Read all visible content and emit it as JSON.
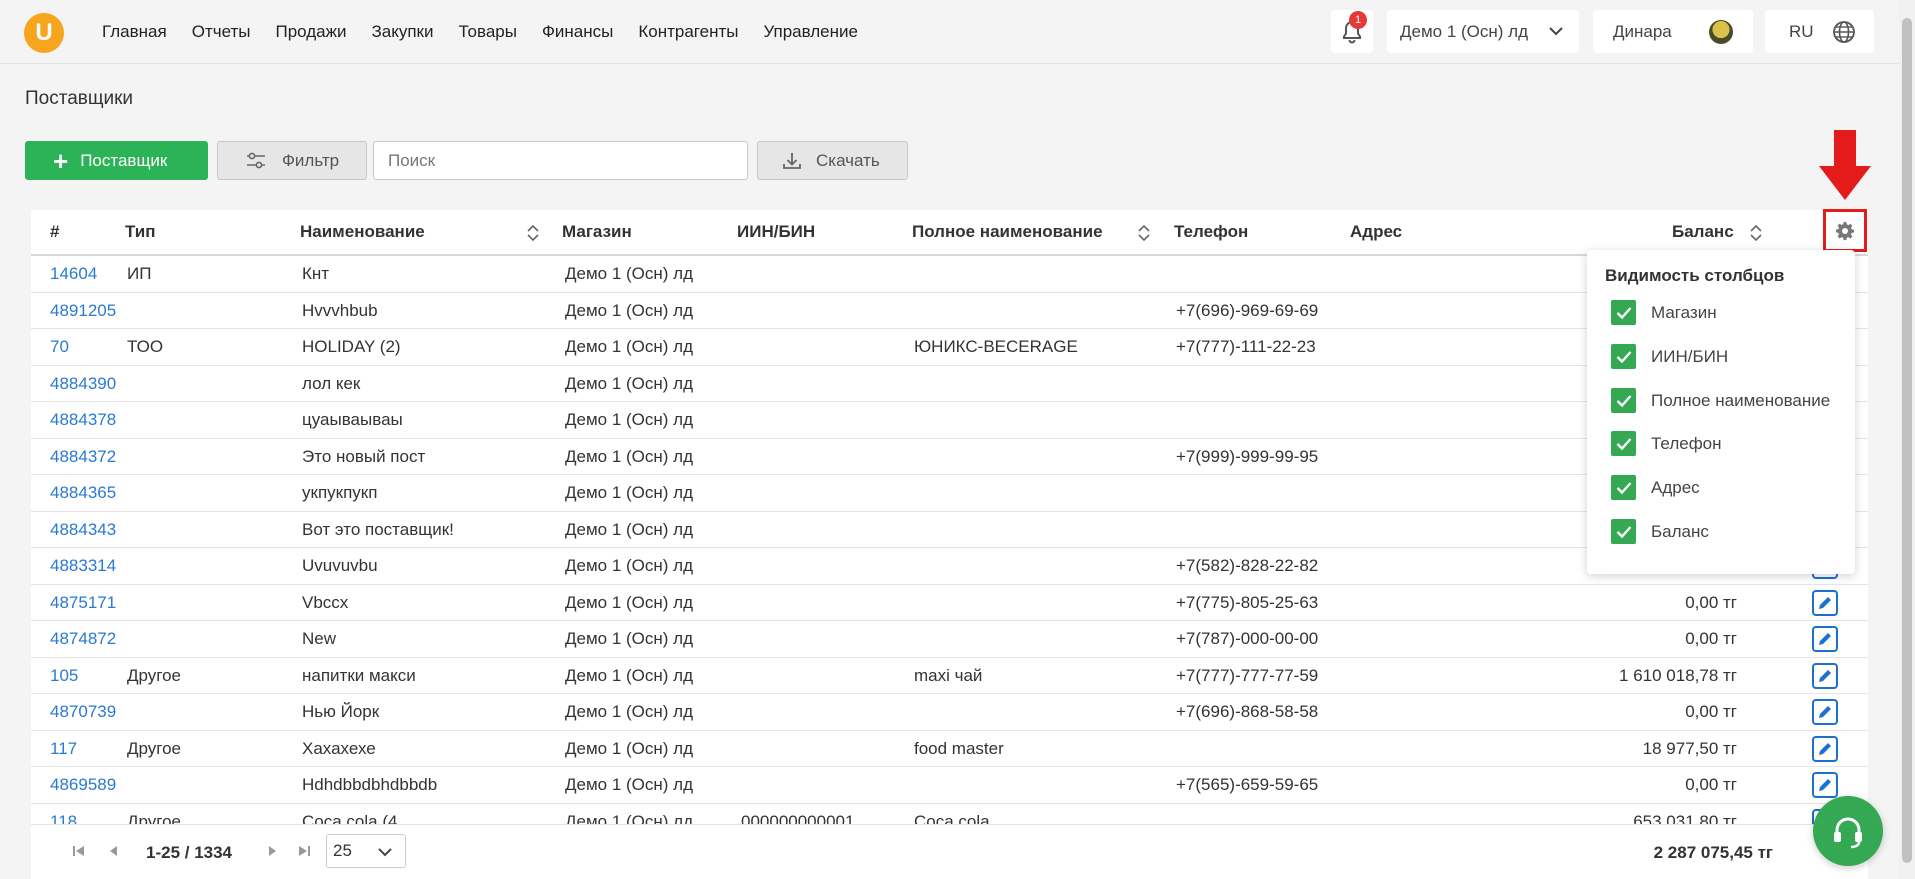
{
  "app": {
    "logo_letter": "U",
    "nav": [
      "Главная",
      "Отчеты",
      "Продажи",
      "Закупки",
      "Товары",
      "Финансы",
      "Контрагенты",
      "Управление"
    ],
    "notifications_count": "1",
    "store_selector": "Демо 1 (Осн) лд",
    "user_name": "Динара",
    "language": "RU"
  },
  "page": {
    "title": "Поставщики",
    "toolbar": {
      "add_label": "Поставщик",
      "filter_label": "Фильтр",
      "search_placeholder": "Поиск",
      "download_label": "Скачать"
    }
  },
  "table": {
    "headers": {
      "id": "#",
      "type": "Тип",
      "name": "Наименование",
      "shop": "Магазин",
      "iin": "ИИН/БИН",
      "full_name": "Полное наименование",
      "phone": "Телефон",
      "address": "Адрес",
      "balance": "Баланс"
    },
    "rows": [
      {
        "id": "14604",
        "type": "ИП",
        "name": "Кнт",
        "shop": "Демо 1 (Осн) лд",
        "iin": "",
        "full_name": "",
        "phone": "",
        "balance": ""
      },
      {
        "id": "4891205",
        "type": "",
        "name": "Hvvvhbub",
        "shop": "Демо 1 (Осн) лд",
        "iin": "",
        "full_name": "",
        "phone": "+7(696)-969-69-69",
        "balance": ""
      },
      {
        "id": "70",
        "type": "ТОО",
        "name": "HOLIDAY (2)",
        "shop": "Демо 1 (Осн) лд",
        "iin": "",
        "full_name": "ЮНИКС-BECERAGE",
        "phone": "+7(777)-111-22-23",
        "balance": ""
      },
      {
        "id": "4884390",
        "type": "",
        "name": "лол кек",
        "shop": "Демо 1 (Осн) лд",
        "iin": "",
        "full_name": "",
        "phone": "",
        "balance": ""
      },
      {
        "id": "4884378",
        "type": "",
        "name": "цуаываываы",
        "shop": "Демо 1 (Осн) лд",
        "iin": "",
        "full_name": "",
        "phone": "",
        "balance": ""
      },
      {
        "id": "4884372",
        "type": "",
        "name": "Это новый пост",
        "shop": "Демо 1 (Осн) лд",
        "iin": "",
        "full_name": "",
        "phone": "+7(999)-999-99-95",
        "balance": ""
      },
      {
        "id": "4884365",
        "type": "",
        "name": "укпукпукп",
        "shop": "Демо 1 (Осн) лд",
        "iin": "",
        "full_name": "",
        "phone": "",
        "balance": ""
      },
      {
        "id": "4884343",
        "type": "",
        "name": "Вот это поставщик!",
        "shop": "Демо 1 (Осн) лд",
        "iin": "",
        "full_name": "",
        "phone": "",
        "balance": ""
      },
      {
        "id": "4883314",
        "type": "",
        "name": "Uvuvuvbu",
        "shop": "Демо 1 (Осн) лд",
        "iin": "",
        "full_name": "",
        "phone": "+7(582)-828-22-82",
        "balance": ""
      },
      {
        "id": "4875171",
        "type": "",
        "name": "Vbccx",
        "shop": "Демо 1 (Осн) лд",
        "iin": "",
        "full_name": "",
        "phone": "+7(775)-805-25-63",
        "balance": "0,00 тг"
      },
      {
        "id": "4874872",
        "type": "",
        "name": "New",
        "shop": "Демо 1 (Осн) лд",
        "iin": "",
        "full_name": "",
        "phone": "+7(787)-000-00-00",
        "balance": "0,00 тг"
      },
      {
        "id": "105",
        "type": "Другое",
        "name": "напитки макси",
        "shop": "Демо 1 (Осн) лд",
        "iin": "",
        "full_name": "maxi чай",
        "phone": "+7(777)-777-77-59",
        "balance": "1 610 018,78 тг"
      },
      {
        "id": "4870739",
        "type": "",
        "name": "Нью Йорк",
        "shop": "Демо 1 (Осн) лд",
        "iin": "",
        "full_name": "",
        "phone": "+7(696)-868-58-58",
        "balance": "0,00 тг"
      },
      {
        "id": "117",
        "type": "Другое",
        "name": "Хахахехе",
        "shop": "Демо 1 (Осн) лд",
        "iin": "",
        "full_name": "food master",
        "phone": "",
        "balance": "18 977,50 тг"
      },
      {
        "id": "4869589",
        "type": "",
        "name": "Hdhdbbdbhdbbdb",
        "shop": "Демо 1 (Осн) лд",
        "iin": "",
        "full_name": "",
        "phone": "+7(565)-659-59-65",
        "balance": "0,00 тг"
      },
      {
        "id": "118",
        "type": "Другое",
        "name": "Coca cola (4",
        "shop": "Демо 1 (Осн) лд",
        "iin": "000000000001",
        "full_name": "Coca cola",
        "phone": "",
        "balance": "653 031,80 тг"
      }
    ]
  },
  "column_visibility": {
    "title": "Видимость столбцов",
    "items": [
      "Магазин",
      "ИИН/БИН",
      "Полное наименование",
      "Телефон",
      "Адрес",
      "Баланс"
    ]
  },
  "pagination": {
    "range": "1-25 / 1334",
    "page_size": "25",
    "total": "2 287 075,45 тг"
  },
  "colors": {
    "accent_green": "#2db357",
    "link_blue": "#2a7ad2",
    "highlight_red": "#e41b1b",
    "logo_orange": "#f7a51c"
  }
}
